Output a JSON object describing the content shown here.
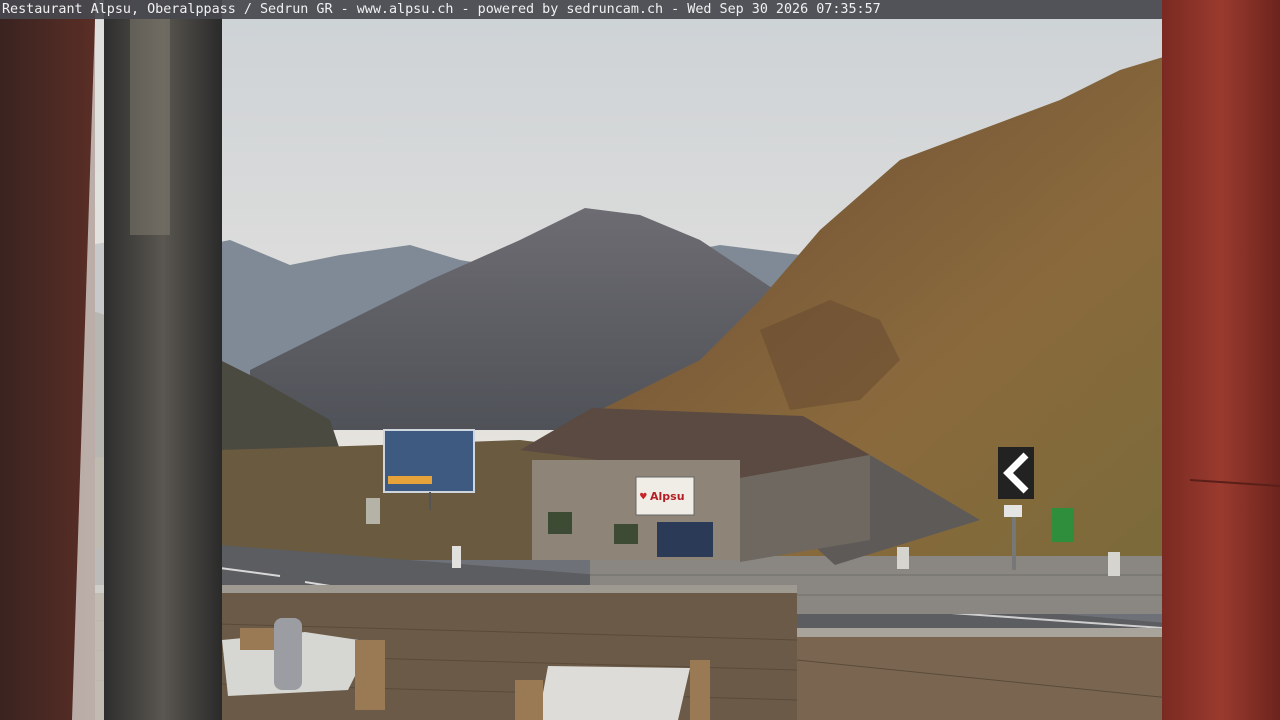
{
  "caption": {
    "text": "Restaurant Alpsu, Oberalppass / Sedrun GR - www.alpsu.ch - powered by sedruncam.ch -  Wed Sep 30 2026 07:35:57"
  },
  "signs": {
    "building_sign": "Alpsu"
  },
  "colors": {
    "sky_top": "#cfd3d6",
    "sky_bottom": "#e8e6e2",
    "mountain_far": "#7a8592",
    "mountain_mid": "#5d6068",
    "hillside": "#7b5b3a",
    "road": "#5a5b5e",
    "post_red": "#8a2f25"
  }
}
